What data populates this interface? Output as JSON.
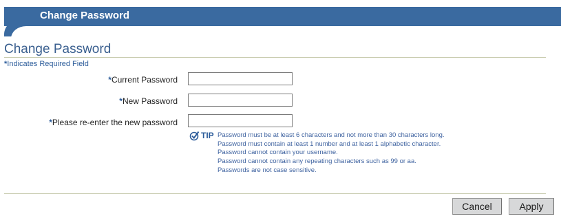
{
  "header": {
    "title": "Change Password"
  },
  "page": {
    "title": "Change Password",
    "required_note": "Indicates Required Field",
    "required_marker": "*"
  },
  "form": {
    "fields": [
      {
        "label": "Current Password",
        "value": ""
      },
      {
        "label": "New Password",
        "value": ""
      },
      {
        "label": "Please re-enter the new password",
        "value": ""
      }
    ]
  },
  "tip": {
    "label": "TIP",
    "lines": [
      "Password must be at least 6 characters and not more than 30 characters long.",
      "Password must contain at least 1 number and at least 1 alphabetic character.",
      "Password cannot contain your username.",
      "Password cannot contain any repeating characters such as 99 or aa.",
      "Passwords are not case sensitive."
    ]
  },
  "actions": {
    "cancel_label": "Cancel",
    "apply_label": "Apply"
  },
  "colors": {
    "brand": "#3a6aa0",
    "link_text": "#2c5c9a",
    "rule": "#c9ccb0"
  }
}
